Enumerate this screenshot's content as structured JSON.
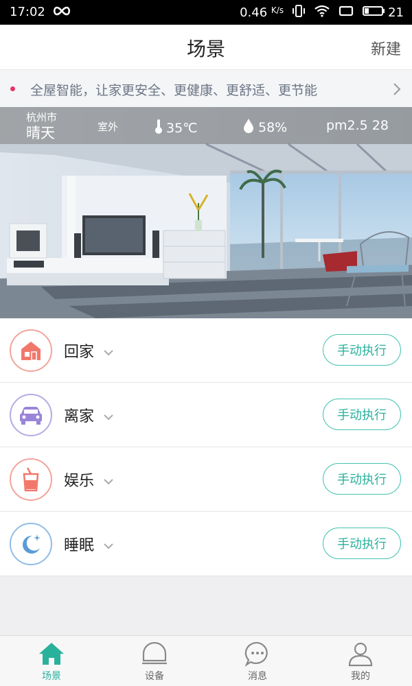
{
  "status_bar": {
    "time": "17:02",
    "speed": "0.46",
    "speed_unit": "K/s",
    "battery": "21"
  },
  "header": {
    "title": "场景",
    "new_label": "新建"
  },
  "banner": {
    "text": "全屋智能，让家更安全、更健康、更舒适、更节能",
    "dot_color": "#e8336a"
  },
  "weather": {
    "city": "杭州市",
    "condition": "晴天",
    "outside_label": "室外",
    "temperature": "35℃",
    "humidity": "58%",
    "pm": "pm2.5 28"
  },
  "scenes": [
    {
      "label": "回家",
      "icon": "home-icon",
      "color": "#f2776b",
      "button": "手动执行"
    },
    {
      "label": "离家",
      "icon": "car-icon",
      "color": "#9a85d8",
      "button": "手动执行"
    },
    {
      "label": "娱乐",
      "icon": "drink-icon",
      "color": "#f2776b",
      "button": "手动执行"
    },
    {
      "label": "睡眠",
      "icon": "moon-icon",
      "color": "#5b9bd5",
      "button": "手动执行"
    }
  ],
  "bottom_nav": [
    {
      "label": "场景",
      "icon": "home-icon",
      "active": true
    },
    {
      "label": "设备",
      "icon": "device-icon",
      "active": false
    },
    {
      "label": "消息",
      "icon": "message-icon",
      "active": false
    },
    {
      "label": "我的",
      "icon": "profile-icon",
      "active": false
    }
  ],
  "colors": {
    "accent": "#2ab19c",
    "accent_border": "#45c3b0"
  }
}
